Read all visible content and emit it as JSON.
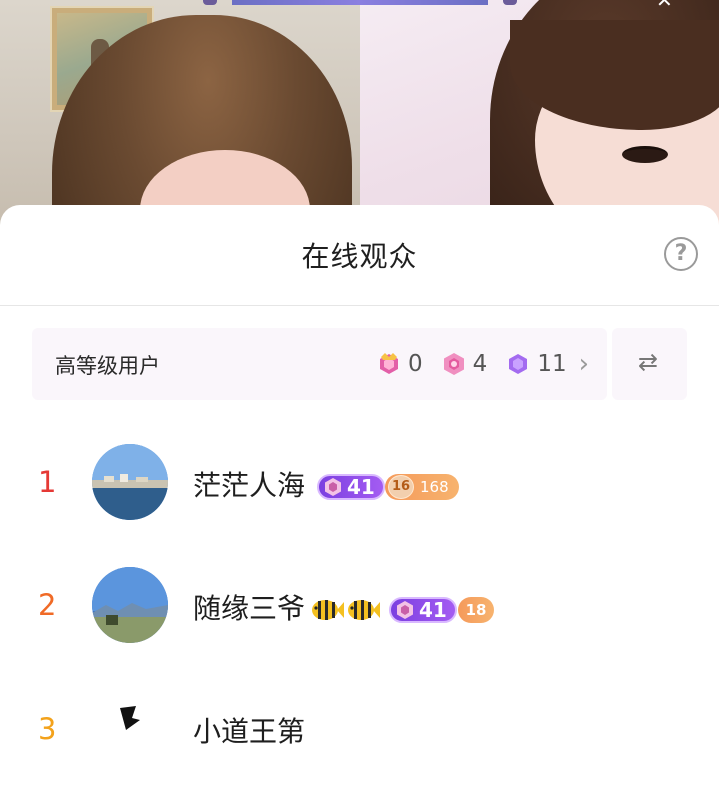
{
  "sheet": {
    "title": "在线观众"
  },
  "level_filter": {
    "label": "高等级用户",
    "counts": [
      {
        "icon": "crown-gem-icon",
        "value": "0"
      },
      {
        "icon": "pink-gem-icon",
        "value": "4"
      },
      {
        "icon": "purple-gem-icon",
        "value": "11"
      }
    ]
  },
  "viewers": [
    {
      "rank": "1",
      "name": "茫茫人海",
      "level": "41",
      "fan_club_level": "16",
      "fan_club_score": "168",
      "rank_color": "#e53935"
    },
    {
      "rank": "2",
      "name": "随缘三爷",
      "level": "41",
      "fan_club_level": "18",
      "rank_color": "#f06a26"
    },
    {
      "rank": "3",
      "name": "小道王第",
      "rank_color": "#f3a21b"
    }
  ],
  "colors": {
    "rank_1": "#e53935",
    "rank_2": "#f06a26",
    "level_badge": "#8a4af0",
    "fan_badge": "#f59a5b"
  }
}
